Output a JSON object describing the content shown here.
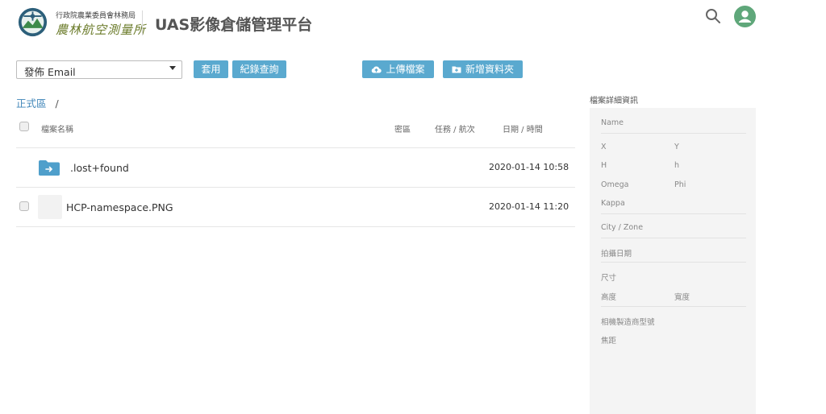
{
  "header": {
    "org_name": "行政院農業委員會林務局",
    "org_script": "農林航空測量所",
    "app_title": "UAS影像倉儲管理平台",
    "search_icon": "search-icon",
    "avatar_icon": "user-icon",
    "avatar_color": "#5fa77a"
  },
  "toolbar": {
    "filter_value": "發佈 Email",
    "apply_label": "套用",
    "log_label": "紀錄查詢",
    "upload_label": "上傳檔案",
    "upload_icon": "cloud-upload-icon",
    "new_folder_label": "新增資料夾",
    "new_folder_icon": "folder-plus-icon",
    "button_color": "#5aa9cf"
  },
  "breadcrumb": {
    "root": "正式區",
    "separator": "/"
  },
  "table": {
    "columns": {
      "name": "檔案名稱",
      "secret": "密區",
      "task": "任務 / 航次",
      "datetime": "日期 / 時間"
    },
    "rows": [
      {
        "type": "folder",
        "icon": "folder-icon",
        "name": ".lost+found",
        "datetime": "2020-01-14 10:58"
      },
      {
        "type": "file",
        "name": "HCP-namespace.PNG",
        "datetime": "2020-01-14 11:20"
      }
    ]
  },
  "details": {
    "title": "檔案詳細資訊",
    "name": "Name",
    "x": "X",
    "y": "Y",
    "h_upper": "H",
    "h_lower": "h",
    "omega": "Omega",
    "phi": "Phi",
    "kappa": "Kappa",
    "city_zone": "City / Zone",
    "shoot_date": "拍攝日期",
    "size": "尺寸",
    "height": "高度",
    "width": "寬度",
    "camera_model": "相機製造商型號",
    "focal_length": "焦距"
  }
}
